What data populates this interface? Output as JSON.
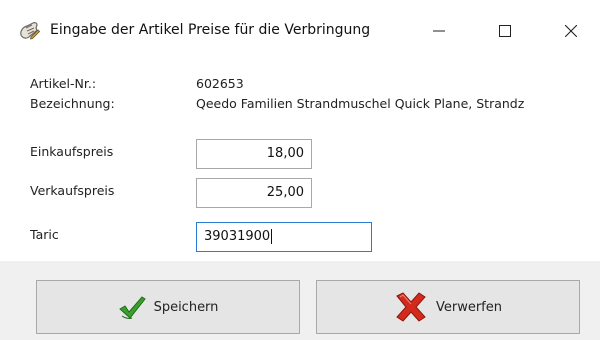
{
  "window": {
    "title": "Eingabe der Artikel Preise für die Verbringung",
    "app_icon": "hand-pen-icon",
    "controls": [
      "minimize-icon",
      "maximize-icon",
      "close-icon"
    ]
  },
  "details": {
    "article_no_label": "Artikel-Nr.:",
    "article_no_value": "602653",
    "description_label": "Bezeichnung:",
    "description_value": "Qeedo Familien Strandmuschel Quick Plane, Strandz"
  },
  "form": {
    "purchase_price_label": "Einkaufspreis",
    "purchase_price_value": "18,00",
    "sales_price_label": "Verkaufspreis",
    "sales_price_value": "25,00",
    "taric_label": "Taric",
    "taric_value": "39031900"
  },
  "buttons": {
    "save_label": "Speichern",
    "save_icon": "green-checkmark-icon",
    "discard_label": "Verwerfen",
    "discard_icon": "red-x-icon"
  },
  "colors": {
    "active_field_border": "#2a7fd4",
    "button_face": "#e5e5e5",
    "footer_bg": "#f0f0f0"
  }
}
